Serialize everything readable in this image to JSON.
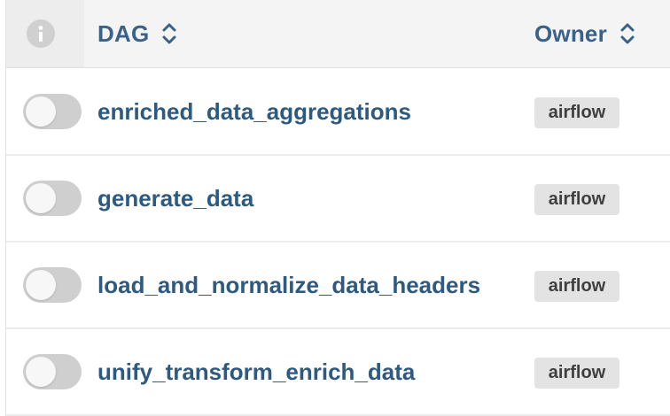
{
  "header": {
    "dag_label": "DAG",
    "owner_label": "Owner",
    "info_icon": "info-icon",
    "sort_icon": "sort-updown-icon"
  },
  "rows": [
    {
      "dag": "enriched_data_aggregations",
      "owner": "airflow",
      "paused": true
    },
    {
      "dag": "generate_data",
      "owner": "airflow",
      "paused": true
    },
    {
      "dag": "load_and_normalize_data_headers",
      "owner": "airflow",
      "paused": true
    },
    {
      "dag": "unify_transform_enrich_data",
      "owner": "airflow",
      "paused": true
    }
  ],
  "colors": {
    "link": "#2f5a80",
    "header_text": "#3a6187",
    "toggle_off": "#cfcfcf",
    "badge_bg": "#e3e3e3"
  }
}
